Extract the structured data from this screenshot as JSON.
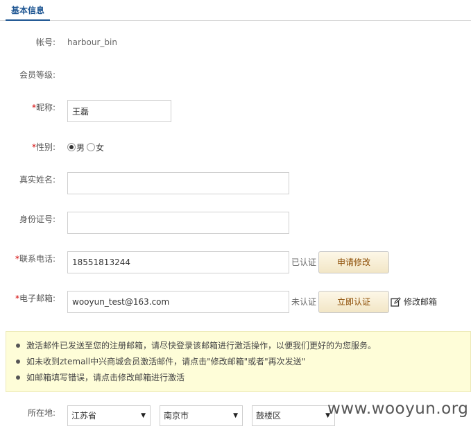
{
  "tab": {
    "title": "基本信息"
  },
  "fields": {
    "account": {
      "label": "帐号:",
      "value": "harbour_bin"
    },
    "level": {
      "label": "会员等级:"
    },
    "nickname": {
      "required": "*",
      "label": "昵称:",
      "value": "王磊"
    },
    "gender": {
      "required": "*",
      "label": "性别:",
      "options": [
        "男",
        "女"
      ],
      "selected": "男"
    },
    "realname": {
      "label": "真实姓名:",
      "value": ""
    },
    "idcard": {
      "label": "身份证号:",
      "value": ""
    },
    "phone": {
      "required": "*",
      "label": "联系电话:",
      "value": "18551813244",
      "status": "已认证",
      "button": "申请修改"
    },
    "email": {
      "required": "*",
      "label": "电子邮箱:",
      "value": "wooyun_test@163.com",
      "status": "未认证",
      "button": "立即认证",
      "edit_link": "修改邮箱"
    },
    "location": {
      "label": "所在地:",
      "province": "江苏省",
      "city": "南京市",
      "district": "鼓楼区"
    }
  },
  "notice": {
    "items": [
      "激活邮件已发送至您的注册邮箱，请尽快登录该邮箱进行激活操作，以便我们更好的为您服务。",
      "如未收到ztemall中兴商城会员激活邮件，请点击\"修改邮箱\"或者\"再次发送\"",
      "如邮箱填写错误，请点击修改邮箱进行激活"
    ]
  },
  "watermark": "www.wooyun.org",
  "colors": {
    "accent": "#1d5592",
    "required": "#d20000",
    "notice_bg": "#fefdd8",
    "button_text": "#8a4a00"
  }
}
